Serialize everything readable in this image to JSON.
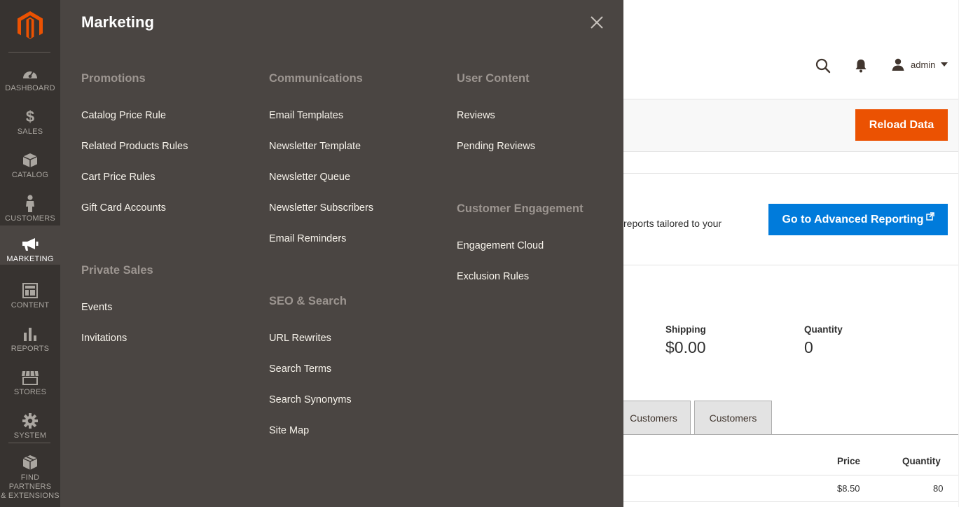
{
  "sidebar": {
    "items": [
      {
        "label": "DASHBOARD",
        "icon": "dashboard-icon"
      },
      {
        "label": "SALES",
        "icon": "dollar-icon"
      },
      {
        "label": "CATALOG",
        "icon": "box-icon"
      },
      {
        "label": "CUSTOMERS",
        "icon": "person-icon"
      },
      {
        "label": "MARKETING",
        "icon": "megaphone-icon",
        "active": true
      },
      {
        "label": "CONTENT",
        "icon": "layout-icon"
      },
      {
        "label": "REPORTS",
        "icon": "bar-chart-icon"
      },
      {
        "label": "STORES",
        "icon": "store-icon"
      },
      {
        "label": "SYSTEM",
        "icon": "gear-icon"
      },
      {
        "label_line1": "FIND PARTNERS",
        "label_line2": "& EXTENSIONS",
        "icon": "extensions-icon"
      }
    ]
  },
  "flyout": {
    "title": "Marketing",
    "groups": {
      "promotions": {
        "title": "Promotions",
        "links": [
          "Catalog Price Rule",
          "Related Products Rules",
          "Cart Price Rules",
          "Gift Card Accounts"
        ]
      },
      "private_sales": {
        "title": "Private Sales",
        "links": [
          "Events",
          "Invitations"
        ]
      },
      "communications": {
        "title": "Communications",
        "links": [
          "Email Templates",
          "Newsletter Template",
          "Newsletter Queue",
          "Newsletter Subscribers",
          "Email Reminders"
        ]
      },
      "seo_search": {
        "title": "SEO & Search",
        "links": [
          "URL Rewrites",
          "Search Terms",
          "Search Synonyms",
          "Site Map"
        ]
      },
      "user_content": {
        "title": "User Content",
        "links": [
          "Reviews",
          "Pending Reviews"
        ]
      },
      "customer_engagement": {
        "title": "Customer Engagement",
        "links": [
          "Engagement Cloud",
          "Exclusion Rules"
        ]
      }
    }
  },
  "header": {
    "user": "admin"
  },
  "actions": {
    "reload": "Reload Data"
  },
  "reporting": {
    "text_fragment": "reports tailored to your",
    "button": "Go to Advanced Reporting"
  },
  "stats": {
    "shipping_label": "Shipping",
    "shipping_value": "$0.00",
    "quantity_label": "Quantity",
    "quantity_value": "0"
  },
  "tabs": [
    "Customers",
    "Customers"
  ],
  "table": {
    "headers": [
      "Price",
      "Quantity"
    ],
    "rows": [
      [
        "$8.50",
        "80"
      ]
    ]
  },
  "colors": {
    "primary_action": "#eb5202",
    "reporting_button": "#007bdb",
    "nav_bg": "#373330",
    "flyout_bg": "#4a4542"
  }
}
